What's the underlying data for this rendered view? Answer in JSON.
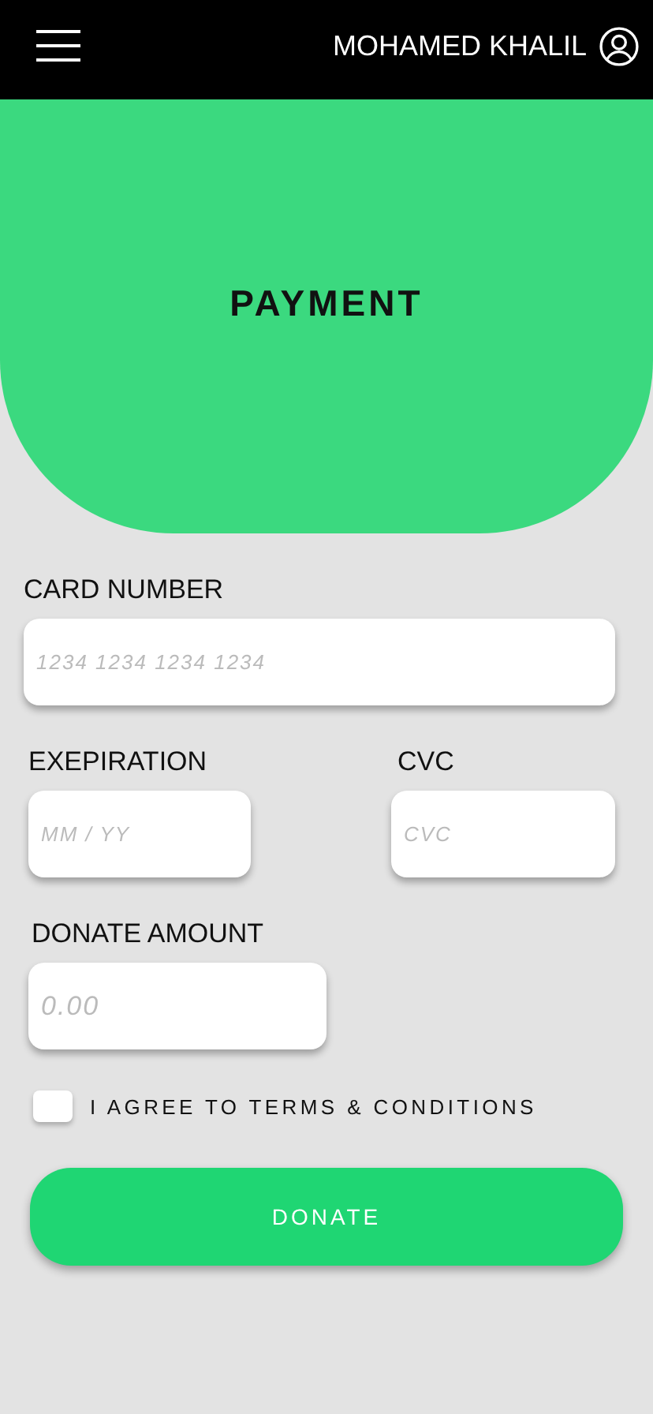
{
  "header": {
    "user_name": "MOHAMED KHALIL"
  },
  "hero": {
    "title": "PAYMENT"
  },
  "fields": [
    {
      "kind": "card",
      "label": "CARD NUMBER",
      "placeholder": "1234 1234 1234 1234"
    },
    {
      "kind": "expiry",
      "label": "EXEPIRATION",
      "placeholder": "MM / YY"
    },
    {
      "kind": "cvc",
      "label": "CVC",
      "placeholder": "CVC"
    },
    {
      "kind": "amount",
      "label": "DONATE AMOUNT",
      "placeholder": "0.00"
    }
  ],
  "terms": {
    "label": "I AGREE TO TERMS & CONDITIONS",
    "checked": false
  },
  "button": "DONATE"
}
